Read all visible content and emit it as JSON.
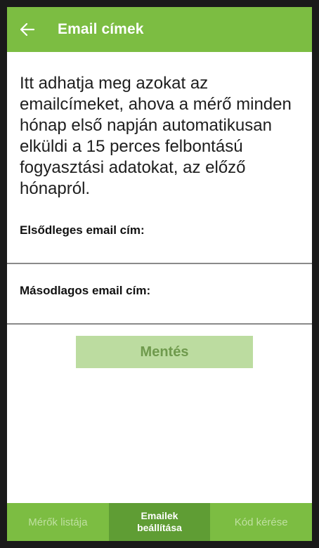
{
  "header": {
    "title": "Email címek",
    "back_icon": "arrow-left-icon"
  },
  "intro_text": "Itt adhatja meg azokat az emailcímeket, ahova a mérő minden hónap első napján automatikusan elküldi a 15 perces felbontású fogyasztási adatokat, az előző hónapról.",
  "fields": {
    "primary_label": "Elsődleges email cím:",
    "primary_value": "",
    "secondary_label": "Másodlagos email cím:",
    "secondary_value": ""
  },
  "save_label": "Mentés",
  "bottom_nav": {
    "items": [
      {
        "label": "Mérők listája",
        "active": false
      },
      {
        "label": "Emailek\nbeállítása",
        "active": true
      },
      {
        "label": "Kód kérése",
        "active": false
      }
    ]
  },
  "colors": {
    "primary": "#7cbd42",
    "primary_dark": "#5f9d34",
    "button_disabled": "#bcdca0",
    "button_text_disabled": "#6f9a4d"
  }
}
